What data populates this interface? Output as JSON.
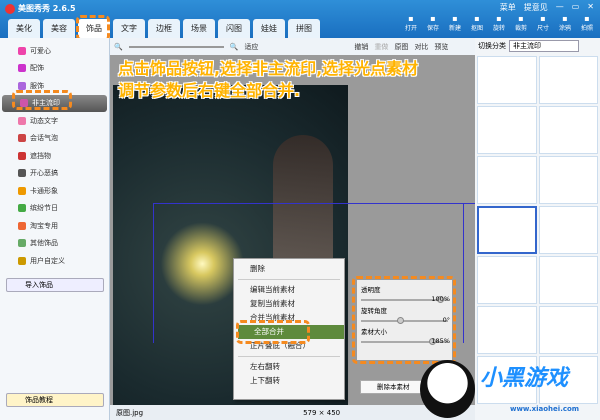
{
  "app": {
    "title": "美图秀秀 2.6.5",
    "menu": "菜单",
    "feedback": "提意见"
  },
  "tabs": [
    "美化",
    "美容",
    "饰品",
    "文字",
    "边框",
    "场景",
    "闪图",
    "娃娃",
    "拼图"
  ],
  "tools": [
    "打开",
    "保存",
    "新建",
    "抠图",
    "旋转",
    "裁剪",
    "尺寸",
    "涂鸦",
    "拍照"
  ],
  "toolbar": {
    "fit": "适应",
    "undo": "撤销",
    "redo": "重做",
    "original": "原图",
    "compare": "对比",
    "preview": "预览"
  },
  "sidebar": {
    "items": [
      "可爱心",
      "配饰",
      "服饰",
      "非主流印",
      "动态文字",
      "会话气泡",
      "遮挡物",
      "开心恶搞",
      "卡通形象",
      "缤纷节日",
      "淘宝专用",
      "其他饰品",
      "用户自定义"
    ],
    "import": "导入饰品",
    "tutorial": "饰品教程"
  },
  "right": {
    "switch_label": "切换分类",
    "category": "非主流印",
    "delete_btn": "删除本素材"
  },
  "instruction": {
    "line1": "点击饰品按钮,选择非主流印,选择光点素材",
    "line2": "调节参数后右键全部合并."
  },
  "context_menu": [
    "删除",
    "编辑当前素材",
    "复制当前素材",
    "合并当前素材",
    "全部合并",
    "正片叠底（融合）",
    "左右翻转",
    "上下翻转"
  ],
  "params": [
    {
      "label": "透明度",
      "value": "100%",
      "level": 1.0
    },
    {
      "label": "旋转角度",
      "value": "0°",
      "level": 0.5
    },
    {
      "label": "素材大小",
      "value": "185%",
      "level": 0.9
    }
  ],
  "status": {
    "filename": "原图.jpg",
    "size": "579 × 450"
  },
  "watermark": {
    "text": "小黑游戏",
    "url": "www.xiaohei.com"
  }
}
